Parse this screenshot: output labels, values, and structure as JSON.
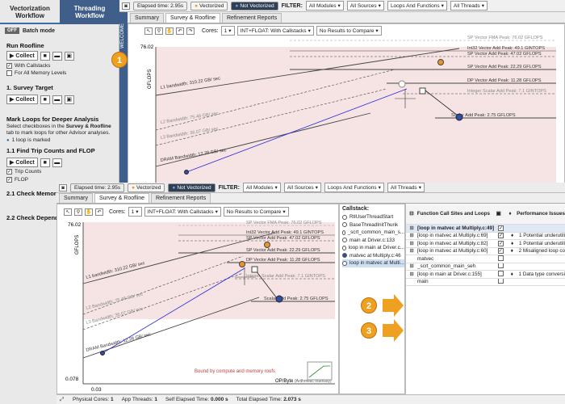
{
  "sidebar": {
    "tabs": [
      "Vectorization Workflow",
      "Threading Workflow"
    ],
    "batch_off": "OFF",
    "batch_label": "Batch mode",
    "run_roofline": "Run Roofline",
    "collect": "Collect",
    "with_callstacks": "With Callstacks",
    "all_memory_levels": "For All Memory Levels",
    "survey_target": "1. Survey Target",
    "mark_loops": "Mark Loops for Deeper Analysis",
    "mark_desc_a": "Select checkboxes in the ",
    "mark_desc_b": "Survey & Roofline",
    "mark_desc_c": " tab to mark loops for other Advisor analyses.",
    "loop_marked": "1 loop is marked",
    "trip_counts": "1.1 Find Trip Counts and FLOP",
    "trip_counts_cb": "Trip Counts",
    "flop_cb": "FLOP",
    "check_memory": "2.1 Check Memory Ac",
    "check_dependencies": "2.2 Check Dependenc",
    "vstrip": "WELCOME"
  },
  "top": {
    "elapsed": "Elapsed time: 2.95s",
    "vectorized": "Vectorized",
    "not_vectorized": "Not Vectorized",
    "filter": "FILTER:",
    "all_modules": "All Modules",
    "all_sources": "All Sources",
    "loops_and_functions": "Loops And Functions",
    "all_threads": "All Threads",
    "tabs": [
      "Summary",
      "Survey & Roofline",
      "Refinement Reports"
    ],
    "cores": "Cores:",
    "cores_val": "1",
    "int_float": "INT+FLOAT: With Callstacks",
    "no_results": "No Results to Compare",
    "y_top": "76.02",
    "ylabel": "GFLOPS",
    "roofs": [
      "SP Vector FMA Peak: 76.02 GFLOPS",
      "Int32 Vector Add Peak: 49.1 GINTOPS",
      "SP Vector Add Peak: 47.02 GFLOPS",
      "SP Vector Add Peak: 22.29 GFLOPS",
      "DP Vector Add Peak: 11.28 GFLOPS",
      "Integer Scalar Add Peak: 7.1 GINTOPS",
      "Scalar Add Peak: 2.75 GFLOPS"
    ],
    "bandwidths": [
      "L1 bandwidth: 310.22 GB/ sec",
      "L2 Bandwidth: 75.48 GB/ sec",
      "L3 Bandwidth: 36.07 GB/ sec",
      "DRAM Bandwidth: 12.28 GB/ sec"
    ]
  },
  "bottom": {
    "elapsed": "Elapsed time: 2.95s",
    "vectorized": "Vectorized",
    "not_vectorized": "Not Vectorized",
    "filter": "FILTER:",
    "all_modules": "All Modules",
    "all_sources": "All Sources",
    "loops_and_functions": "Loops And Functions",
    "all_threads": "All Threads",
    "tabs": [
      "Summary",
      "Survey & Roofline",
      "Refinement Reports"
    ],
    "cores": "Cores:",
    "cores_val": "1",
    "int_float": "INT+FLOAT: With Callstacks",
    "no_results": "No Results to Compare",
    "y_top": "76.02",
    "y_bottom": "0.078",
    "x_left": "0.03",
    "xlabel": "OP/Byte",
    "xlabel_sub": "(Arithmetic Intensity)",
    "ylabel": "GFLOPS",
    "bound_note": "Bound by compute and memory roofs",
    "roofs": [
      "SP Vector FMA Peak: 76.02 GFLOPS",
      "Int32 Vector Add Peak: 49.1 GINTOPS",
      "SP Vector Add Peak: 47.02 GFLOPS",
      "SP Vector Add Peak: 22.29 GFLOPS",
      "DP Vector Add Peak: 11.28 GFLOPS",
      "Integer Scalar Add Peak: 7.1 GINTOPS",
      "Scalar Add Peak: 2.75 GFLOPS"
    ],
    "bandwidths": [
      "L1 bandwidth: 310.22 GB/ sec",
      "L2 Bandwidth: 75.48 GB/ sec",
      "L3 Bandwidth: 36.07 GB/ sec",
      "DRAM Bandwidth: 12.28 GB/ sec"
    ]
  },
  "callstack": {
    "title": "Callstack:",
    "items": [
      "RtlUserThreadStart",
      "BaseThreadInitThunk",
      "_scrt_common_main_s...",
      "main at Driver.c:133",
      "loop in main at Driver.c...",
      "matvec at Multiply.c:46",
      "loop in matvec at Multi..."
    ]
  },
  "grid": {
    "col_sites": "Function Call Sites and Loops",
    "col_perf": "Performance Issues",
    "rows": [
      "[loop in matvec at Multiply.c:49]",
      "[loop in matvec at Multiply.c:69]",
      "[loop in matvec at Multiply.c:82]",
      "[loop in matvec at Multiply.c:60]",
      "matvec",
      "_scrt_common_main_seh",
      "[loop in main at Driver.c:155]",
      "main"
    ],
    "issues": [
      "",
      "1 Potential underutili",
      "1 Potential underutili",
      "2 Misaligned loop co",
      "",
      "",
      "1 Data type conversi",
      ""
    ]
  },
  "status": {
    "physical_cores_label": "Physical Cores:",
    "physical_cores": "1",
    "app_threads_label": "App Threads:",
    "app_threads": "1",
    "self_elapsed_label": "Self Elapsed Time:",
    "self_elapsed": "0.000 s",
    "total_elapsed_label": "Total Elapsed Time:",
    "total_elapsed": "2.073 s"
  },
  "callouts": [
    "1",
    "2",
    "3"
  ],
  "colors": {
    "accent_orange": "#f0a020",
    "sidebar_header": "#3f5f8a",
    "roof_fill": "#f6e4e4",
    "point_blue": "#2f4fa8",
    "point_orange": "#e8952a"
  }
}
